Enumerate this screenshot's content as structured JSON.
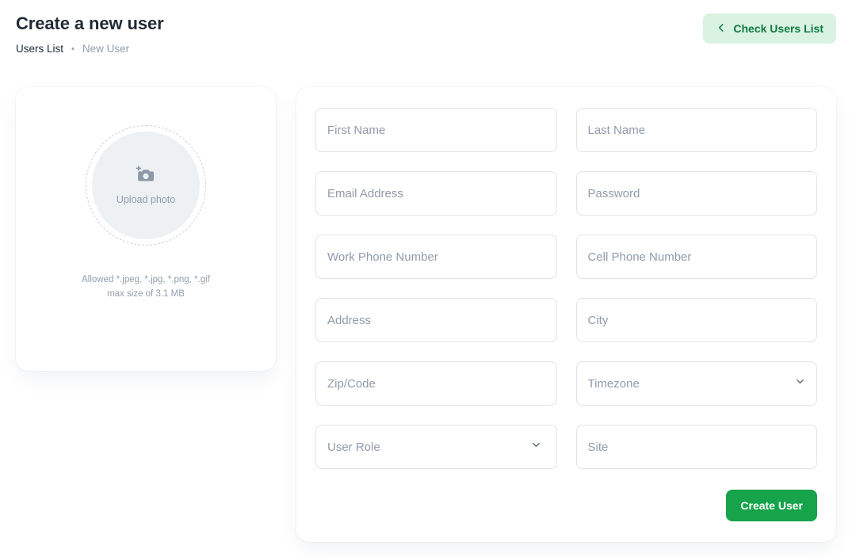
{
  "header": {
    "title": "Create a new user",
    "breadcrumb": {
      "root": "Users List",
      "separator": "•",
      "current": "New User"
    },
    "check_users_button": {
      "label": "Check Users List",
      "icon": "chevron-left-icon",
      "background": "#d9f2e2",
      "text_color": "#117a42"
    }
  },
  "upload": {
    "placeholder_label": "Upload photo",
    "icon": "camera-plus-icon",
    "help_line_1": "Allowed *.jpeg, *.jpg, *.png, *.gif",
    "help_line_2": "max size of 3.1 MB"
  },
  "form": {
    "fields": [
      {
        "name": "first-name",
        "placeholder": "First Name",
        "type": "text",
        "value": ""
      },
      {
        "name": "last-name",
        "placeholder": "Last Name",
        "type": "text",
        "value": ""
      },
      {
        "name": "email-address",
        "placeholder": "Email Address",
        "type": "text",
        "value": ""
      },
      {
        "name": "password",
        "placeholder": "Password",
        "type": "text",
        "value": ""
      },
      {
        "name": "work-phone-number",
        "placeholder": "Work Phone Number",
        "type": "text",
        "value": ""
      },
      {
        "name": "cell-phone-number",
        "placeholder": "Cell Phone Number",
        "type": "text",
        "value": ""
      },
      {
        "name": "address",
        "placeholder": "Address",
        "type": "text",
        "value": ""
      },
      {
        "name": "city",
        "placeholder": "City",
        "type": "text",
        "value": ""
      },
      {
        "name": "zip-code",
        "placeholder": "Zip/Code",
        "type": "text",
        "value": ""
      },
      {
        "name": "timezone",
        "placeholder": "Timezone",
        "type": "select",
        "value": ""
      },
      {
        "name": "user-role",
        "placeholder": "User Role",
        "type": "select",
        "value": ""
      },
      {
        "name": "site",
        "placeholder": "Site",
        "type": "text",
        "value": ""
      }
    ],
    "submit_button": {
      "label": "Create User",
      "background": "#16a34a",
      "text_color": "#ffffff"
    }
  }
}
